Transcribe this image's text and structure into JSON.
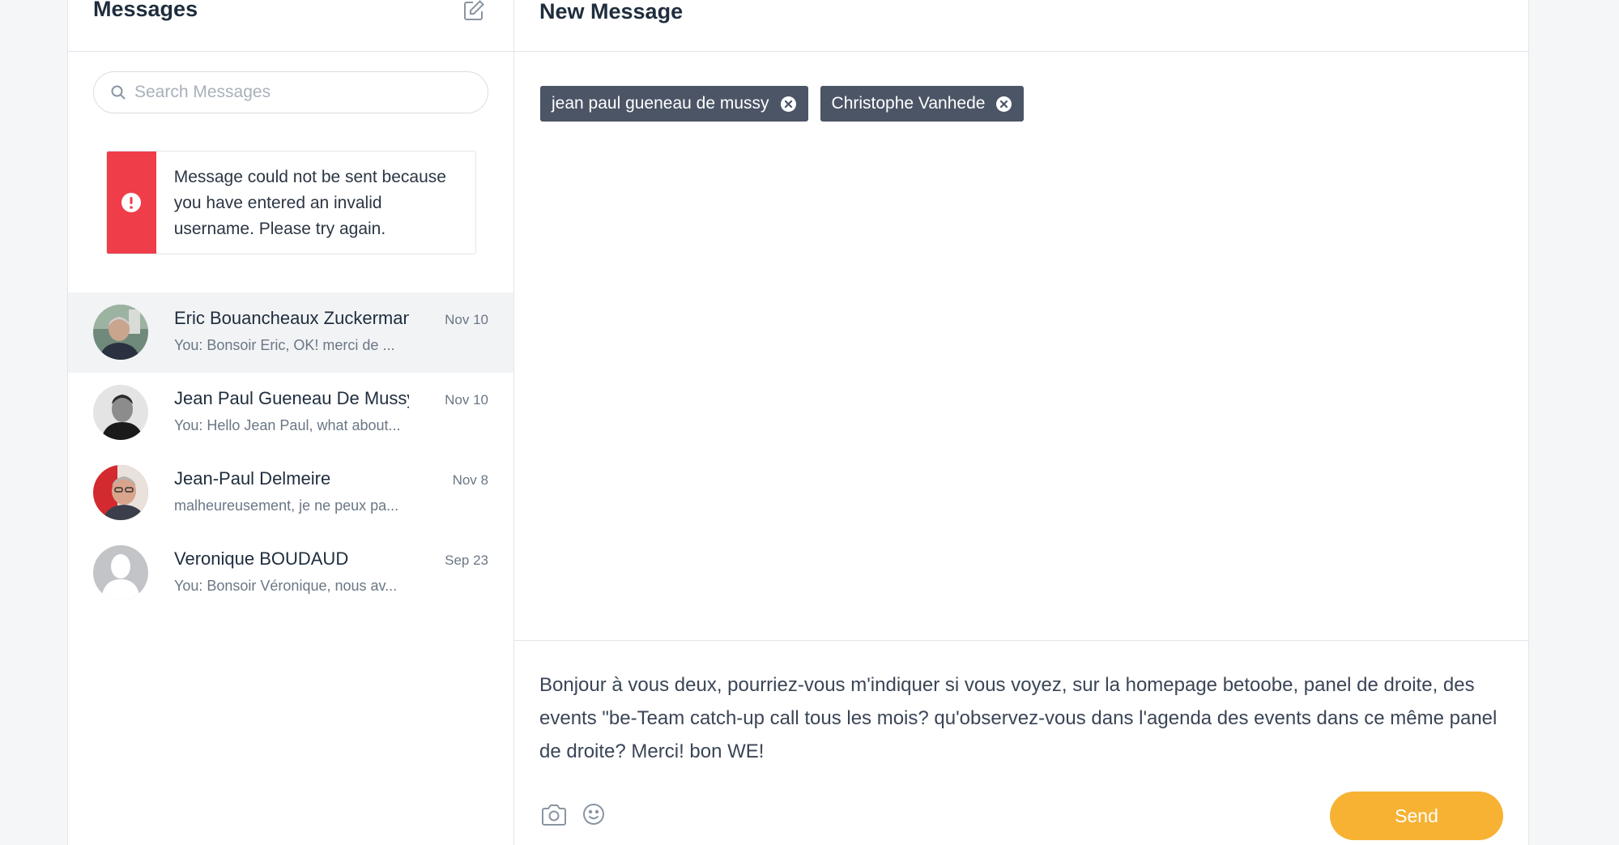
{
  "sidebar": {
    "title": "Messages",
    "search": {
      "placeholder": "Search Messages",
      "value": ""
    },
    "alert": {
      "text": "Message could not be sent because you have entered an invalid username. Please try again."
    },
    "conversations": [
      {
        "name": "Eric Bouancheaux Zuckerman",
        "date": "Nov 10",
        "preview": "You: Bonsoir Eric, OK! merci de ...",
        "active": true
      },
      {
        "name": "Jean Paul Gueneau De Mussy",
        "date": "Nov 10",
        "preview": "You: Hello Jean Paul, what about...",
        "active": false
      },
      {
        "name": "Jean-Paul Delmeire",
        "date": "Nov 8",
        "preview": "malheureusement, je ne peux pa...",
        "active": false
      },
      {
        "name": "Veronique BOUDAUD",
        "date": "Sep 23",
        "preview": "You: Bonsoir Véronique, nous av...",
        "active": false
      }
    ]
  },
  "main": {
    "title": "New Message",
    "recipients": [
      {
        "label": "jean paul gueneau de mussy"
      },
      {
        "label": "Christophe Vanhede"
      }
    ],
    "composer": {
      "text": "Bonjour à vous deux, pourriez-vous m'indiquer si vous voyez, sur la homepage betoobe, panel de droite, des events \"be-Team catch-up call tous les mois? qu'observez-vous dans l'agenda des events dans ce même panel de droite? Merci! bon WE!",
      "send_label": "Send"
    }
  },
  "colors": {
    "accent": "#f7b233",
    "alert": "#ef3d49",
    "chip": "#4b5566"
  }
}
